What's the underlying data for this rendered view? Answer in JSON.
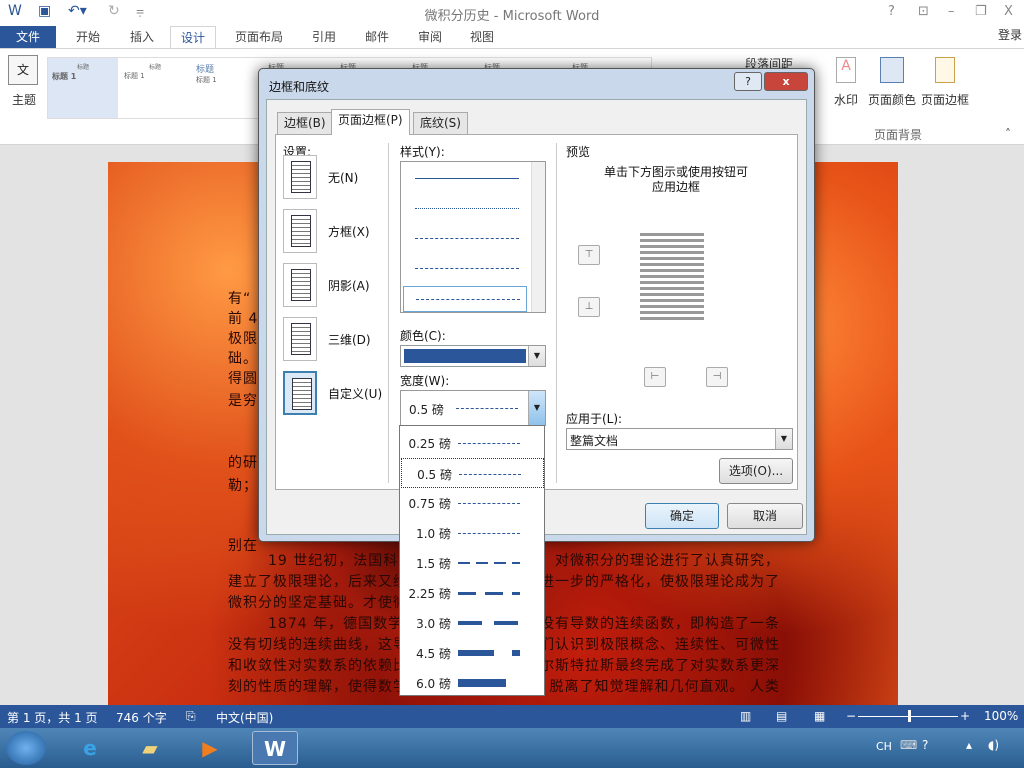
{
  "window": {
    "title": "微积分历史 - Microsoft Word",
    "help": "?",
    "minimize": "–",
    "restore": "❐",
    "close": "X",
    "signin": "登录"
  },
  "ribbon_tabs": [
    "文件",
    "开始",
    "插入",
    "设计",
    "页面布局",
    "引用",
    "邮件",
    "审阅",
    "视图"
  ],
  "ribbon": {
    "theme": "主题",
    "gallery": [
      {
        "title": "标题",
        "heading": "标题 1"
      },
      {
        "title": "标题",
        "heading": "标题 1"
      },
      {
        "title": "标题",
        "heading": "标题 1"
      }
    ],
    "more_titles": [
      "标题",
      "标题",
      "标题",
      "标题",
      "标题"
    ],
    "paragraph_spacing": "段落间距",
    "watermark": "水印",
    "page_color": "页面颜色",
    "page_borders": "页面边框",
    "group_page_background": "页面背景"
  },
  "document": {
    "left_fragments": [
      "有“",
      "前 4",
      "极限",
      "础。",
      "得圆",
      "是穷",
      "的研",
      "勒；",
      "别在"
    ],
    "lines": [
      {
        "left": "19 世纪初，法国科学",
        "right": "言，对微积分的理论进行了认真研究，"
      },
      {
        "left": "建立了极限理论，后来又经",
        "right": "斯进一步的严格化，使极限理论成为了"
      },
      {
        "left": "微积分的坚定基础。才使微积",
        "right": ""
      },
      {
        "left": "1874 年，德国数学家",
        "right": "个没有导数的连续函数，即构造了一条"
      },
      {
        "left": "没有切线的连续曲线，这导致",
        "right": "人们认识到极限概念、连续性、可微性"
      },
      {
        "left": "和收敛性对实数系的依赖比",
        "right": "外尔斯特拉斯最终完成了对实数系更深"
      },
      {
        "left": "刻的性质的理解，使得数学",
        "right": "脱离了知觉理解和几何直观。 人类"
      }
    ]
  },
  "dialog": {
    "title": "边框和底纹",
    "help": "?",
    "close": "x",
    "tabs": [
      "边框(B)",
      "页面边框(P)",
      "底纹(S)"
    ],
    "setting_label": "设置:",
    "settings": [
      "无(N)",
      "方框(X)",
      "阴影(A)",
      "三维(D)",
      "自定义(U)"
    ],
    "style_label": "样式(Y):",
    "color_label": "颜色(C):",
    "color_value": "#2b579a",
    "width_label": "宽度(W):",
    "width_value": "0.5 磅",
    "preview_label": "预览",
    "preview_hint": "单击下方图示或使用按钮可\n应用边框",
    "apply_label": "应用于(L):",
    "apply_value": "整篇文档",
    "options": "选项(O)...",
    "ok": "确定",
    "cancel": "取消"
  },
  "width_options": [
    {
      "label": "0.25 磅",
      "w": 1,
      "sel": false
    },
    {
      "label": "0.5 磅",
      "w": 1,
      "sel": true
    },
    {
      "label": "0.75 磅",
      "w": 1,
      "sel": false
    },
    {
      "label": "1.0 磅",
      "w": 1,
      "sel": false
    },
    {
      "label": "1.5 磅",
      "w": 2,
      "sel": false
    },
    {
      "label": "2.25 磅",
      "w": 3,
      "sel": false
    },
    {
      "label": "3.0 磅",
      "w": 4,
      "sel": false
    },
    {
      "label": "4.5 磅",
      "w": 6,
      "sel": false
    },
    {
      "label": "6.0 磅",
      "w": 8,
      "sel": false
    }
  ],
  "status": {
    "page": "第 1 页，共 1 页",
    "words": "746 个字",
    "language": "中文(中国)",
    "zoom": "100%",
    "zoom_fraction": 0.5
  },
  "taskbar": {
    "lang": "CH"
  }
}
